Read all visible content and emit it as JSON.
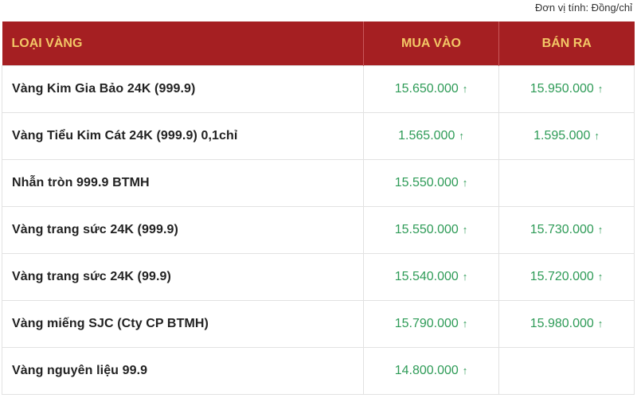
{
  "unit_note": "Đơn vị tính: Đồng/chỉ",
  "colors": {
    "header_bg": "#a51f22",
    "header_text": "#f3c766",
    "price_up": "#2e9b57"
  },
  "table": {
    "headers": {
      "name": "LOẠI VÀNG",
      "buy": "MUA VÀO",
      "sell": "BÁN RA"
    },
    "rows": [
      {
        "name": "Vàng Kim Gia Bảo 24K (999.9)",
        "buy": "15.650.000",
        "buy_icon": "arrow-up-icon",
        "sell": "15.950.000",
        "sell_icon": "arrow-up-icon"
      },
      {
        "name": "Vàng Tiểu Kim Cát 24K (999.9) 0,1chỉ",
        "buy": "1.565.000",
        "buy_icon": "arrow-up-icon",
        "sell": "1.595.000",
        "sell_icon": "arrow-up-icon"
      },
      {
        "name": "Nhẫn tròn 999.9 BTMH",
        "buy": "15.550.000",
        "buy_icon": "arrow-up-icon",
        "sell": "",
        "sell_icon": ""
      },
      {
        "name": "Vàng trang sức 24K (999.9)",
        "buy": "15.550.000",
        "buy_icon": "arrow-up-icon",
        "sell": "15.730.000",
        "sell_icon": "arrow-up-icon"
      },
      {
        "name": "Vàng trang sức 24K (99.9)",
        "buy": "15.540.000",
        "buy_icon": "arrow-up-icon",
        "sell": "15.720.000",
        "sell_icon": "arrow-up-icon"
      },
      {
        "name": "Vàng miếng SJC (Cty CP BTMH)",
        "buy": "15.790.000",
        "buy_icon": "arrow-up-icon",
        "sell": "15.980.000",
        "sell_icon": "arrow-up-icon"
      },
      {
        "name": "Vàng nguyên liệu 99.9",
        "buy": "14.800.000",
        "buy_icon": "arrow-up-icon",
        "sell": "",
        "sell_icon": ""
      }
    ]
  }
}
